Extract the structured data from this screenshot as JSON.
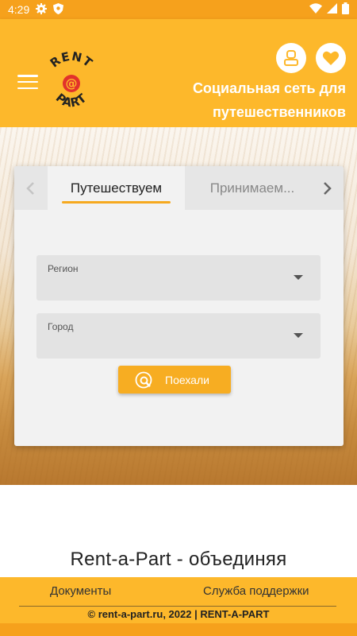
{
  "status_bar": {
    "time": "4:29",
    "icons": [
      "gear-icon",
      "shield-icon",
      "wifi-icon",
      "signal-icon",
      "battery-icon"
    ]
  },
  "header": {
    "logo_text_top": "RENT",
    "logo_text_bottom": "PART",
    "logo_mark": "@",
    "tagline": "Социальная сеть для путешественников",
    "icons": [
      "menu-icon",
      "user-icon",
      "heart-icon"
    ]
  },
  "search_card": {
    "tabs": [
      {
        "label": "Путешествуем",
        "active": true
      },
      {
        "label": "Принимаем...",
        "active": false
      }
    ],
    "region_label": "Регион",
    "region_value": "",
    "city_label": "Город",
    "city_value": "",
    "go_button_label": "Поехали"
  },
  "main": {
    "intro_text": "Rent-a-Part - объединяя"
  },
  "footer": {
    "documents_link": "Документы",
    "support_link": "Служба поддержки",
    "copyright": "© rent-a-part.ru, 2022 | RENT-A-PART"
  },
  "colors": {
    "brand_yellow": "#fdb82b",
    "status_orange": "#f6a11c",
    "button_orange": "#f7ad22",
    "logo_red": "#e2322b"
  }
}
